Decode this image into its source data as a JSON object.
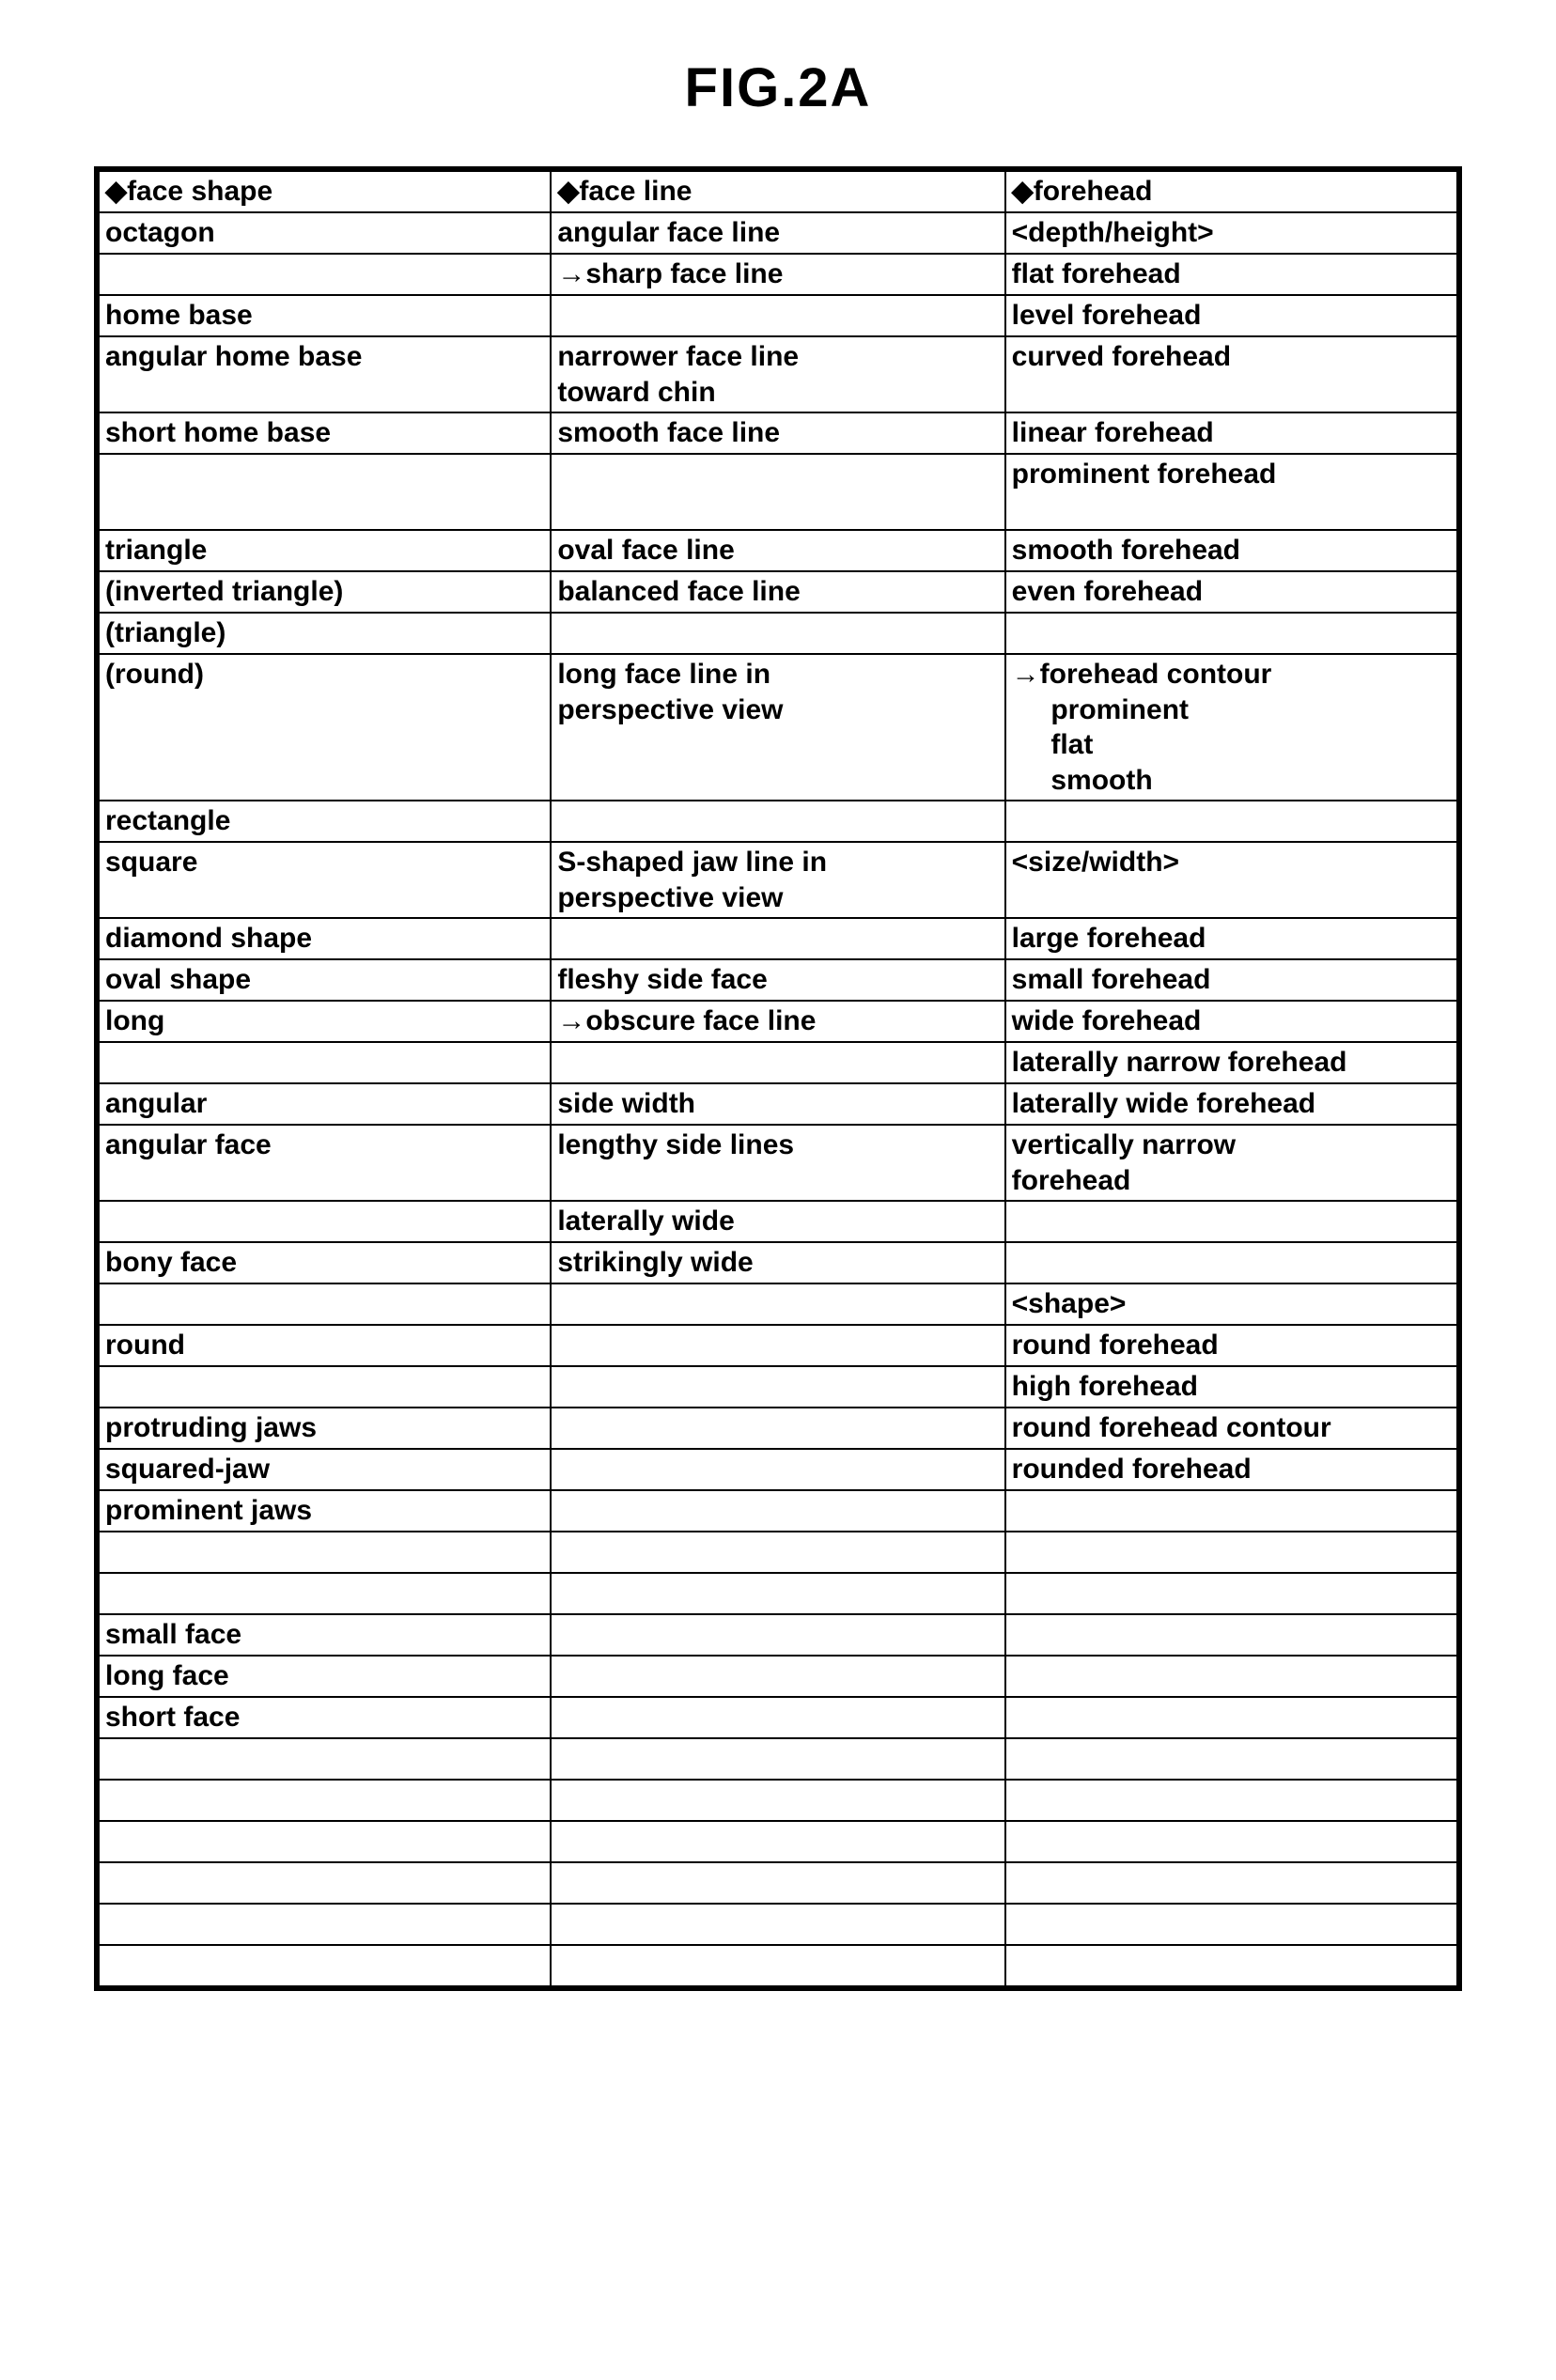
{
  "title": "FIG.2A",
  "columns": 3,
  "rows": [
    [
      "◆face shape",
      "◆face line",
      "◆forehead"
    ],
    [
      "octagon",
      "angular face line",
      "<depth/height>"
    ],
    [
      "",
      "→sharp face line",
      "flat forehead"
    ],
    [
      "home base",
      "",
      "level forehead"
    ],
    [
      "angular home base",
      "narrower face line\ntoward chin",
      "curved forehead"
    ],
    [
      "short home base",
      "smooth face line",
      "linear forehead"
    ],
    [
      "",
      "",
      "prominent forehead\n\n"
    ],
    [
      "triangle\n",
      "oval face line",
      "smooth forehead"
    ],
    [
      "(inverted triangle)\n",
      "balanced face line",
      "even forehead"
    ],
    [
      "(triangle)\n",
      "",
      ""
    ],
    [
      "(round)",
      "long face line in\nperspective view",
      "→forehead contour\n     prominent\n     flat\n     smooth"
    ],
    [
      "rectangle\n",
      "",
      ""
    ],
    [
      "square",
      "S-shaped jaw line in\nperspective view",
      "<size/width>"
    ],
    [
      "diamond shape",
      "",
      "large forehead"
    ],
    [
      "oval shape",
      "fleshy side face",
      "small forehead"
    ],
    [
      "long",
      "→obscure face line",
      "wide forehead"
    ],
    [
      "",
      "",
      "laterally narrow forehead\n"
    ],
    [
      "angular",
      "side width",
      "laterally wide forehead"
    ],
    [
      "angular face",
      "lengthy side lines",
      "vertically narrow\nforehead"
    ],
    [
      "",
      "laterally wide",
      ""
    ],
    [
      "bony face",
      "strikingly wide",
      ""
    ],
    [
      "",
      "",
      "<shape>"
    ],
    [
      "round",
      "",
      "round forehead"
    ],
    [
      "",
      "",
      "high forehead"
    ],
    [
      "protruding jaws",
      "",
      "round forehead contour"
    ],
    [
      "squared-jaw",
      "",
      "rounded forehead"
    ],
    [
      "prominent jaws",
      "",
      ""
    ],
    [
      "",
      "",
      ""
    ],
    [
      "",
      "",
      ""
    ],
    [
      "small face",
      "",
      ""
    ],
    [
      "long face",
      "",
      ""
    ],
    [
      "short face",
      "",
      ""
    ],
    [
      "",
      "",
      ""
    ],
    [
      "",
      "",
      ""
    ],
    [
      "",
      "",
      ""
    ],
    [
      "",
      "",
      ""
    ],
    [
      "",
      "",
      ""
    ],
    [
      "",
      "",
      ""
    ]
  ]
}
